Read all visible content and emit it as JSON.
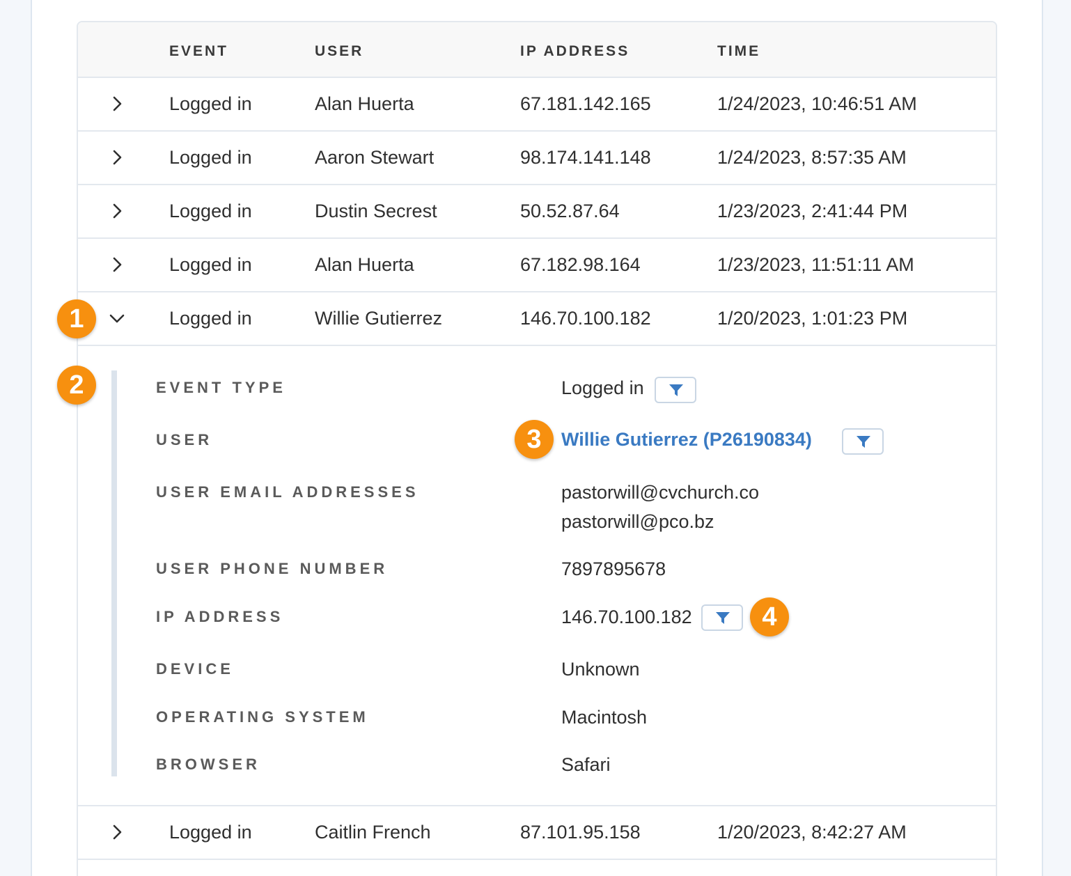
{
  "table": {
    "headers": {
      "event": "EVENT",
      "user": "USER",
      "ip": "IP ADDRESS",
      "time": "TIME"
    },
    "rows": [
      {
        "event": "Logged in",
        "user": "Alan Huerta",
        "ip": "67.181.142.165",
        "time": "1/24/2023, 10:46:51 AM"
      },
      {
        "event": "Logged in",
        "user": "Aaron Stewart",
        "ip": "98.174.141.148",
        "time": "1/24/2023, 8:57:35 AM"
      },
      {
        "event": "Logged in",
        "user": "Dustin Secrest",
        "ip": "50.52.87.64",
        "time": "1/23/2023, 2:41:44 PM"
      },
      {
        "event": "Logged in",
        "user": "Alan Huerta",
        "ip": "67.182.98.164",
        "time": "1/23/2023, 11:51:11 AM"
      },
      {
        "event": "Logged in",
        "user": "Willie Gutierrez",
        "ip": "146.70.100.182",
        "time": "1/20/2023, 1:01:23 PM"
      },
      {
        "event": "Logged in",
        "user": "Caitlin French",
        "ip": "87.101.95.158",
        "time": "1/20/2023, 8:42:27 AM"
      }
    ]
  },
  "detail": {
    "labels": {
      "event_type": "EVENT TYPE",
      "user": "USER",
      "emails": "USER EMAIL ADDRESSES",
      "phone": "USER PHONE NUMBER",
      "ip": "IP ADDRESS",
      "device": "DEVICE",
      "os": "OPERATING SYSTEM",
      "browser": "BROWSER"
    },
    "values": {
      "event_type": "Logged in",
      "user": "Willie Gutierrez (P26190834)",
      "email_1": "pastorwill@cvchurch.co",
      "email_2": "pastorwill@pco.bz",
      "phone": "7897895678",
      "ip": "146.70.100.182",
      "device": "Unknown",
      "os": "Macintosh",
      "browser": "Safari"
    }
  },
  "badges": [
    "1",
    "2",
    "3",
    "4"
  ],
  "icons": {
    "collapsed": "chevron-right-icon",
    "expanded": "chevron-down-icon",
    "filter": "filter-icon"
  },
  "colors": {
    "accent": "#3a7ac2",
    "badge": "#f7900f",
    "border": "#e3e8ee"
  }
}
